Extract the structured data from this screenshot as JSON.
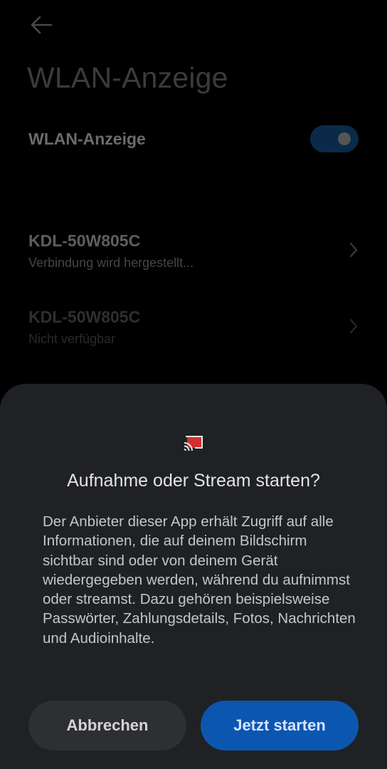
{
  "page": {
    "title": "WLAN-Anzeige",
    "toggle_label": "WLAN-Anzeige",
    "toggle_on": true,
    "devices": [
      {
        "name": "KDL-50W805C",
        "status": "Verbindung wird hergestellt..."
      },
      {
        "name": "KDL-50W805C",
        "status": "Nicht verfügbar"
      }
    ]
  },
  "dialog": {
    "icon": "cast-icon",
    "title": "Aufnahme oder Stream starten?",
    "body": "Der Anbieter dieser App erhält Zugriff auf alle Informationen, die auf deinem Bildschirm sichtbar sind oder von deinem Gerät wiedergegeben werden, während du aufnimmst oder streamst. Dazu gehören beispielsweise Passwörter, Zahlungsdetails, Fotos, Nachrichten und Audioinhalte.",
    "cancel_label": "Abbrechen",
    "start_label": "Jetzt starten"
  },
  "colors": {
    "accent": "#0b57b0",
    "sheet_bg": "#202124",
    "cast_red": "#d32f2f"
  }
}
